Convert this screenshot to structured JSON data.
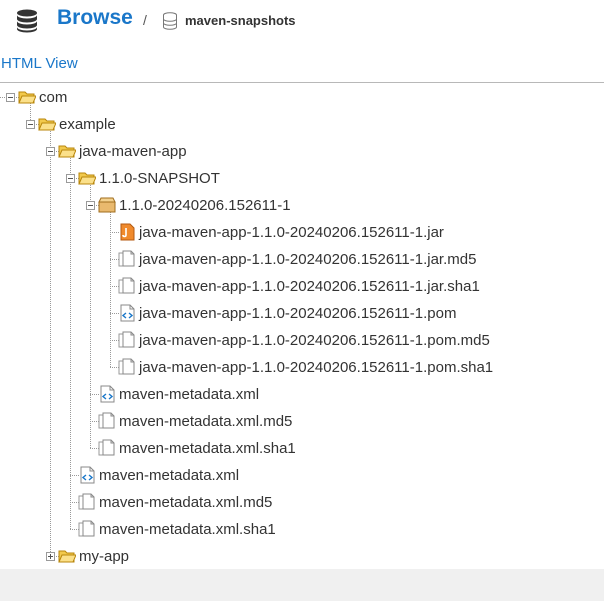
{
  "header": {
    "title": "Browse",
    "separator": "/",
    "repository": "maven-snapshots"
  },
  "html_view": "HTML View",
  "tree": [
    {
      "label": "com",
      "type": "folder",
      "toggle": "minus"
    },
    {
      "label": "example",
      "type": "folder",
      "toggle": "minus"
    },
    {
      "label": "java-maven-app",
      "type": "folder",
      "toggle": "minus"
    },
    {
      "label": "1.1.0-SNAPSHOT",
      "type": "folder",
      "toggle": "minus"
    },
    {
      "label": "1.1.0-20240206.152611-1",
      "type": "component",
      "toggle": "minus"
    },
    {
      "label": "java-maven-app-1.1.0-20240206.152611-1.jar",
      "type": "jar"
    },
    {
      "label": "java-maven-app-1.1.0-20240206.152611-1.jar.md5",
      "type": "file"
    },
    {
      "label": "java-maven-app-1.1.0-20240206.152611-1.jar.sha1",
      "type": "file"
    },
    {
      "label": "java-maven-app-1.1.0-20240206.152611-1.pom",
      "type": "xml"
    },
    {
      "label": "java-maven-app-1.1.0-20240206.152611-1.pom.md5",
      "type": "file"
    },
    {
      "label": "java-maven-app-1.1.0-20240206.152611-1.pom.sha1",
      "type": "file"
    },
    {
      "label": "maven-metadata.xml",
      "type": "xml"
    },
    {
      "label": "maven-metadata.xml.md5",
      "type": "file"
    },
    {
      "label": "maven-metadata.xml.sha1",
      "type": "file"
    },
    {
      "label": "maven-metadata.xml",
      "type": "xml"
    },
    {
      "label": "maven-metadata.xml.md5",
      "type": "file"
    },
    {
      "label": "maven-metadata.xml.sha1",
      "type": "file"
    },
    {
      "label": "my-app",
      "type": "folder",
      "toggle": "plus"
    }
  ],
  "colors": {
    "link": "#1a77c9",
    "folder": "#f5c542",
    "jar": "#e8731e"
  }
}
